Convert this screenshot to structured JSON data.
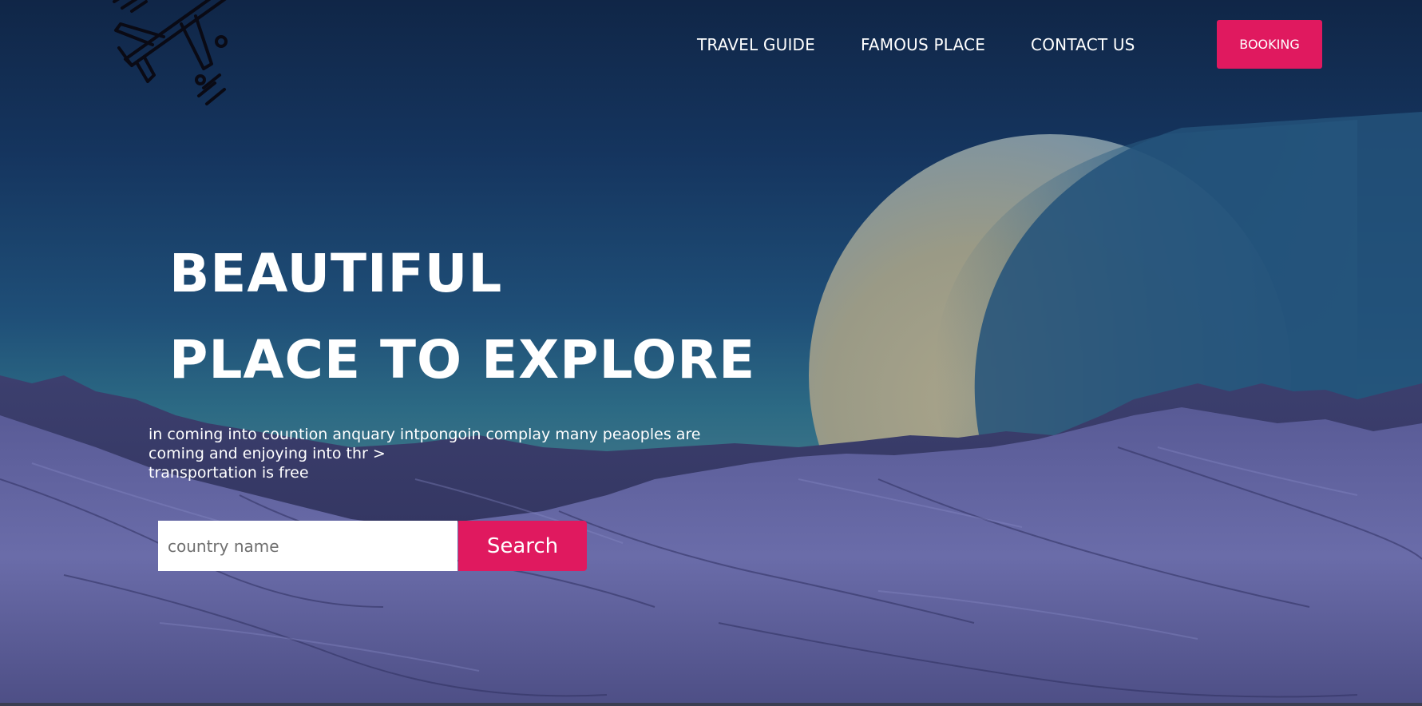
{
  "logo": {
    "icon": "airplane-icon"
  },
  "nav": {
    "links": [
      {
        "label": "TRAVEL GUIDE"
      },
      {
        "label": "FAMOUS PLACE"
      },
      {
        "label": "CONTACT US"
      }
    ],
    "booking_label": "BOOKING"
  },
  "hero": {
    "headline_line1": "BEAUTIFUL",
    "headline_line2": "PLACE TO EXPLORE",
    "description_line1": "in coming into countion anquary intpongoin complay many peaoples are",
    "description_line2": "coming and enjoying into thr >",
    "description_line3": "transportation is free"
  },
  "search": {
    "placeholder": "country name",
    "value": "",
    "button_label": "Search"
  },
  "colors": {
    "accent": "#e0195f",
    "text": "#ffffff",
    "sky_top": "#102647",
    "terrain": "#5a5a9a"
  }
}
